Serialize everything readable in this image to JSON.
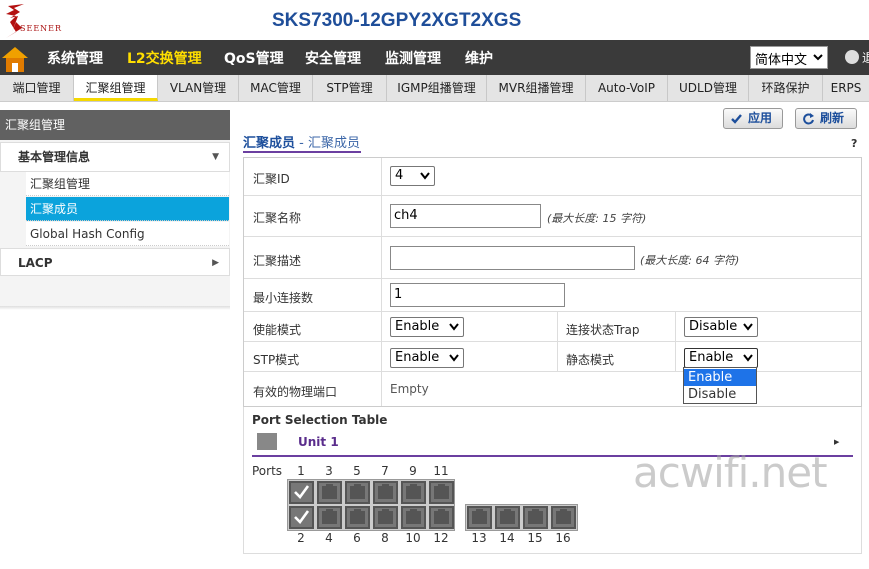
{
  "header": {
    "logo_text": "SEENER",
    "model": "SKS7300-12GPY2XGT2XGS"
  },
  "mainnav": {
    "items": [
      "系统管理",
      "L2交换管理",
      "QoS管理",
      "安全管理",
      "监测管理",
      "维护"
    ],
    "active_index": 1,
    "language": "简体中文",
    "logout_label": "退"
  },
  "subnav": {
    "items": [
      "端口管理",
      "汇聚组管理",
      "VLAN管理",
      "MAC管理",
      "STP管理",
      "IGMP组播管理",
      "MVR组播管理",
      "Auto-VoIP",
      "UDLD管理",
      "环路保护",
      "ERPS"
    ],
    "active_index": 1
  },
  "sidebar": {
    "title": "汇聚组管理",
    "group1": "基本管理信息",
    "items": [
      "汇聚组管理",
      "汇聚成员",
      "Global Hash Config"
    ],
    "active_item": 1,
    "group2": "LACP"
  },
  "actions": {
    "apply": "应用",
    "refresh": "刷新"
  },
  "section": {
    "title_highlight": "汇聚成员",
    "title_sep": " - ",
    "title_sub": "汇聚成员",
    "help": "?"
  },
  "form": {
    "lag_id_label": "汇聚ID",
    "lag_id_value": "4",
    "name_label": "汇聚名称",
    "name_value": "ch4",
    "name_hint": "(最大长度: 15 字符)",
    "desc_label": "汇聚描述",
    "desc_value": "",
    "desc_hint": "(最大长度: 64 字符)",
    "min_links_label": "最小连接数",
    "min_links_value": "1",
    "admin_mode_label": "使能模式",
    "admin_mode_value": "Enable",
    "link_trap_label": "连接状态Trap",
    "link_trap_value": "Disable",
    "stp_mode_label": "STP模式",
    "stp_mode_value": "Enable",
    "static_mode_label": "静态模式",
    "static_mode_value": "Enable",
    "static_mode_options": [
      "Enable",
      "Disable"
    ],
    "active_ports_label": "有效的物理端口",
    "active_ports_value": "Empty"
  },
  "ports": {
    "title": "Port Selection Table",
    "unit": "Unit 1",
    "label": "Ports",
    "top_numbers": [
      "1",
      "3",
      "5",
      "7",
      "9",
      "11"
    ],
    "bottom_numbers": [
      "2",
      "4",
      "6",
      "8",
      "10",
      "12",
      "13",
      "14",
      "15",
      "16"
    ],
    "checked_ports": [
      "1",
      "2"
    ]
  },
  "watermark": "acwifi.net",
  "colors": {
    "nav_bg": "#3a3a3a",
    "nav_active": "#ffde00",
    "accent_blue": "#1d4f9c",
    "sidebar_active": "#0ba3dc",
    "purple_line": "#6b3fa0"
  }
}
